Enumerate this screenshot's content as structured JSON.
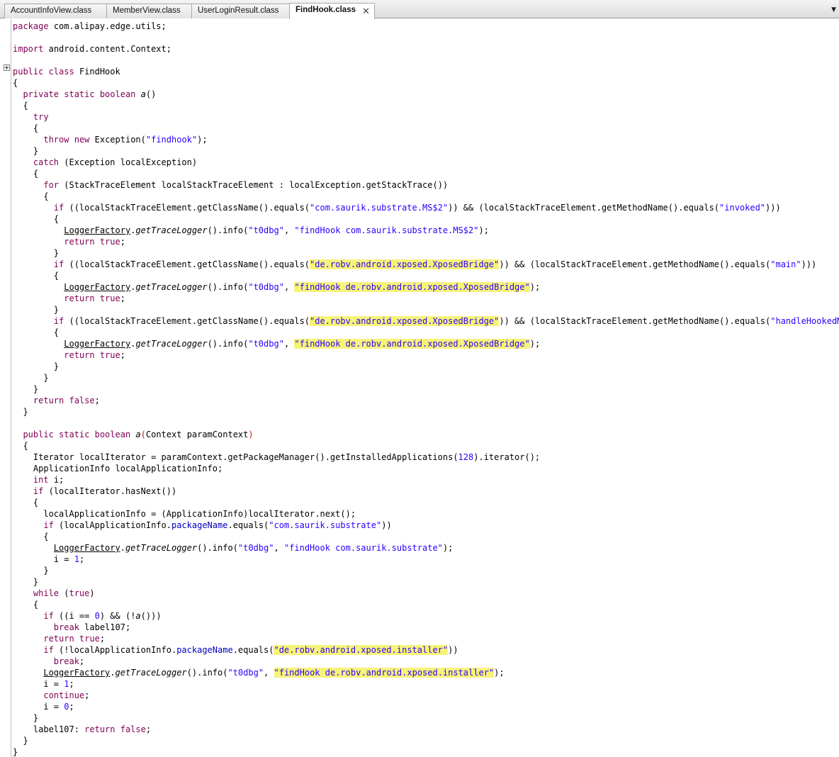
{
  "tabs": [
    {
      "label": "AccountInfoView.class",
      "active": false
    },
    {
      "label": "MemberView.class",
      "active": false
    },
    {
      "label": "UserLoginResult.class",
      "active": false
    },
    {
      "label": "FindHook.class",
      "active": true,
      "close": "✕"
    }
  ],
  "tab_menu_icon": "chevron-down-icon",
  "colors": {
    "keyword": "#7f0055",
    "string": "#2a00ff",
    "highlight": "#f7f37a"
  },
  "code": {
    "package_stmt": "com.alipay.edge.utils;",
    "import_stmt": "android.content.Context;",
    "class_name": "FindHook",
    "method1_name": "a",
    "exc_msg": "\"findhook\"",
    "stack_type": "StackTraceElement",
    "loop_var": "localStackTraceElement",
    "exc_var": "localException",
    "str_ms2": "\"com.saurik.substrate.MS$2\"",
    "str_invoked": "\"invoked\"",
    "str_xposed_bridge": "\"de.robv.android.xposed.XposedBridge\"",
    "str_main": "\"main\"",
    "str_handle_hooked": "\"handleHookedMethod\")))",
    "log_tag": "\"t0dbg\"",
    "log_ms2": "\"findHook com.saurik.substrate.MS$2\"",
    "log_xposed_bridge": "\"findHook de.robv.android.xposed.XposedBridge\"",
    "param_type": "Context",
    "param_name": "paramContext",
    "installed_flag": "128",
    "str_substrate": "\"com.saurik.substrate\"",
    "log_substrate": "\"findHook com.saurik.substrate\"",
    "str_installer": "\"de.robv.android.xposed.installer\"",
    "log_installer": "\"findHook de.robv.android.xposed.installer\"",
    "label": "label107",
    "val_zero": "0",
    "val_one": "1"
  }
}
